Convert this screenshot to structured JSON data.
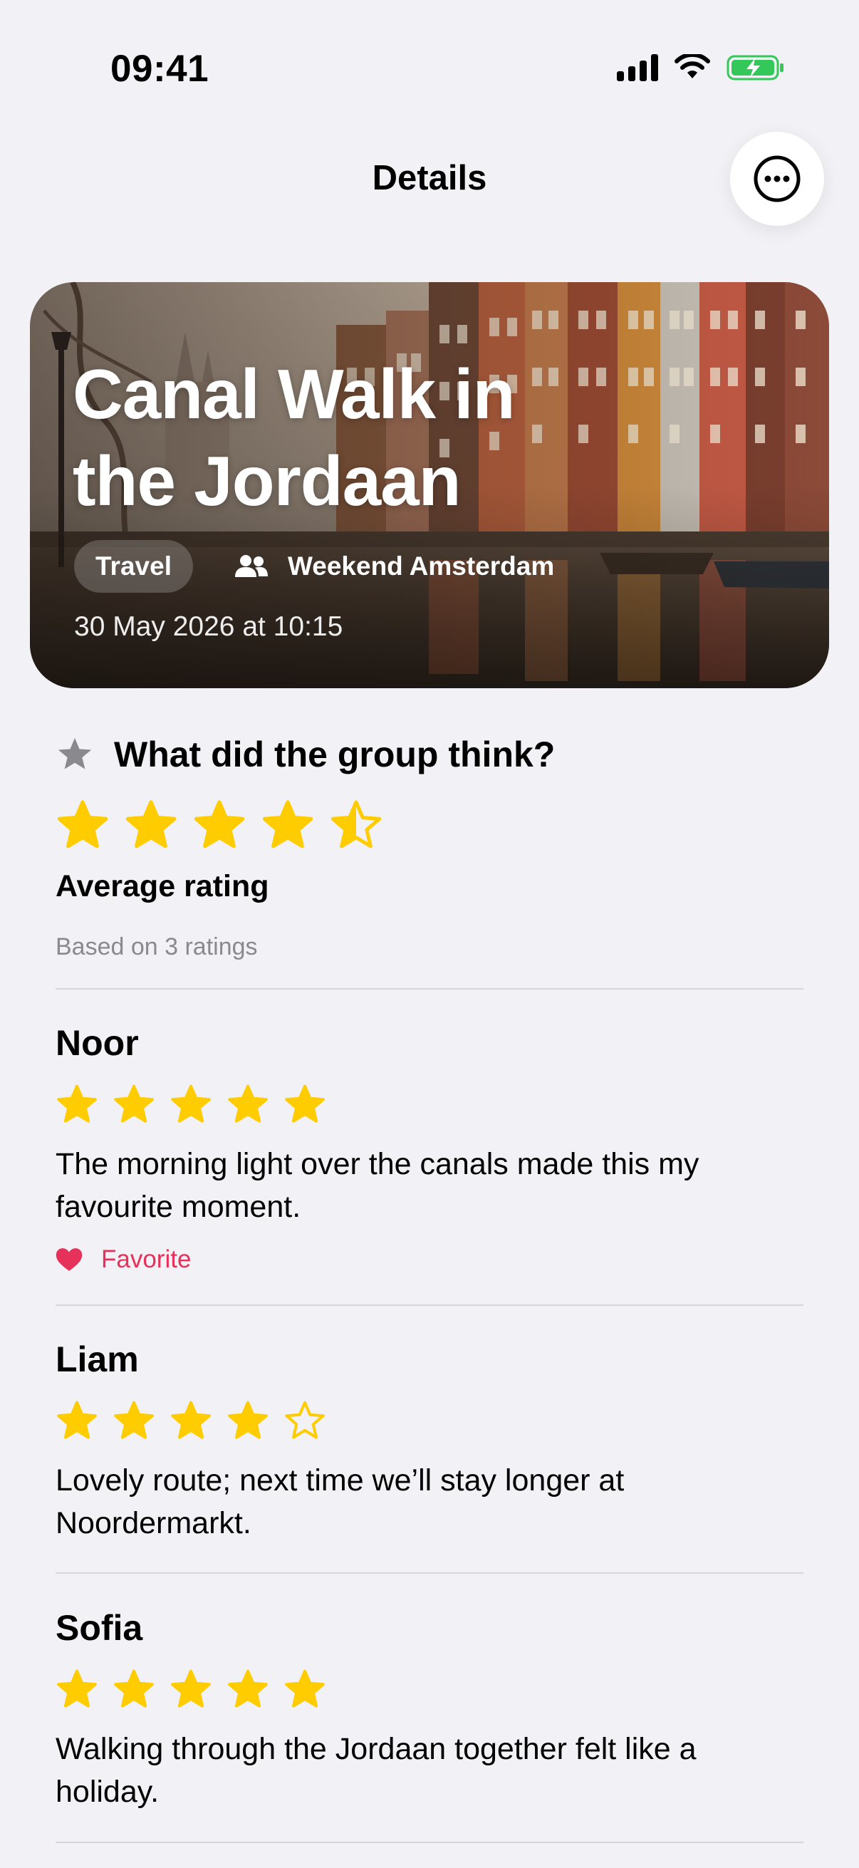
{
  "status_bar": {
    "time": "09:41"
  },
  "nav": {
    "title": "Details",
    "more_icon": "ellipsis-circle-icon"
  },
  "hero": {
    "title_line1": "Canal Walk in",
    "title_line2": "the Jordaan",
    "category": "Travel",
    "group_icon": "people-icon",
    "group": "Weekend Amsterdam",
    "datetime": "30 May 2026 at 10:15"
  },
  "ratings": {
    "section_icon": "star-icon",
    "section_title": "What did the group think?",
    "average_value": 4.5,
    "average_label": "Average rating",
    "based_on": "Based on 3 ratings"
  },
  "reviews": [
    {
      "name": "Noor",
      "rating": 5,
      "text": "The morning light over the canals made this my favourite moment.",
      "favorite": true,
      "favorite_label": "Favorite",
      "favorite_icon": "heart-icon"
    },
    {
      "name": "Liam",
      "rating": 4,
      "text": "Lovely route; next time we’ll stay longer at Noordermarkt.",
      "favorite": false
    },
    {
      "name": "Sofia",
      "rating": 5,
      "text": "Walking through the Jordaan together felt like a holiday.",
      "favorite": false
    }
  ],
  "colors": {
    "background": "#f2f1f6",
    "star": "#ffcc00",
    "favorite": "#e6325a",
    "battery": "#34c759"
  }
}
